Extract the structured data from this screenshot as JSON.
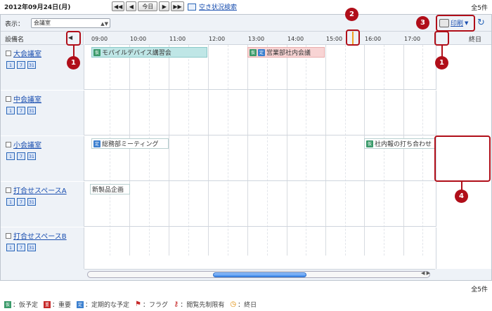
{
  "header": {
    "date": "2012年09月24日(月)",
    "nav": {
      "prev_week": "◀◀",
      "prev_day": "◀",
      "today": "今日",
      "next_day": "▶",
      "next_week": "▶▶"
    },
    "search_link": "空き状況検索",
    "total": "全5件"
  },
  "toolbar": {
    "display_label": "表示：",
    "select_value": "会議室",
    "print_label": "印刷",
    "refresh": "↻"
  },
  "grid": {
    "name_header": "設備名",
    "allday_header": "終日",
    "times": [
      "09:00",
      "10:00",
      "11:00",
      "12:00",
      "13:00",
      "14:00",
      "15:00",
      "16:00",
      "17:00"
    ]
  },
  "rooms": [
    {
      "name": "大会議室",
      "icons": [
        "1",
        "7",
        "31"
      ]
    },
    {
      "name": "中会議室",
      "icons": [
        "1",
        "7",
        "31"
      ]
    },
    {
      "name": "小会議室",
      "icons": [
        "1",
        "7",
        "31"
      ]
    },
    {
      "name": "打合せスペースA",
      "icons": [
        "1",
        "7",
        "31"
      ]
    },
    {
      "name": "打合せスペースB",
      "icons": [
        "1",
        "7",
        "31"
      ]
    }
  ],
  "events": [
    {
      "title": "モバイルデバイス講習会",
      "tags": [
        "仮"
      ],
      "color": "#bfe6e6"
    },
    {
      "title": "営業部社内会議",
      "tags": [
        "仮",
        "定"
      ],
      "color": "#f8d4d4"
    },
    {
      "title": "総務部ミーティング",
      "tags": [
        "定"
      ],
      "color": "#ffffff"
    },
    {
      "title": "社内報の打ち合わせ",
      "tags": [
        "仮"
      ],
      "color": "#ffffff"
    },
    {
      "title": "新製品企画",
      "tags": [],
      "color": "#ffffff"
    }
  ],
  "footer": {
    "total": "全5件",
    "legend": [
      {
        "icon": "仮",
        "label": "：仮予定"
      },
      {
        "icon": "重",
        "label": "：重要"
      },
      {
        "icon": "定",
        "label": "：定期的な予定"
      },
      {
        "icon": "flag-icon",
        "label": "：フラグ"
      },
      {
        "icon": "key-icon",
        "label": "：閲覧先制限有"
      },
      {
        "icon": "clock-icon",
        "label": "：終日"
      }
    ]
  },
  "callouts": [
    "1",
    "2",
    "3",
    "1",
    "4"
  ],
  "colors": {
    "accent": "#b00e19",
    "link": "#1a4fb0",
    "now_line": "#f0a020"
  }
}
